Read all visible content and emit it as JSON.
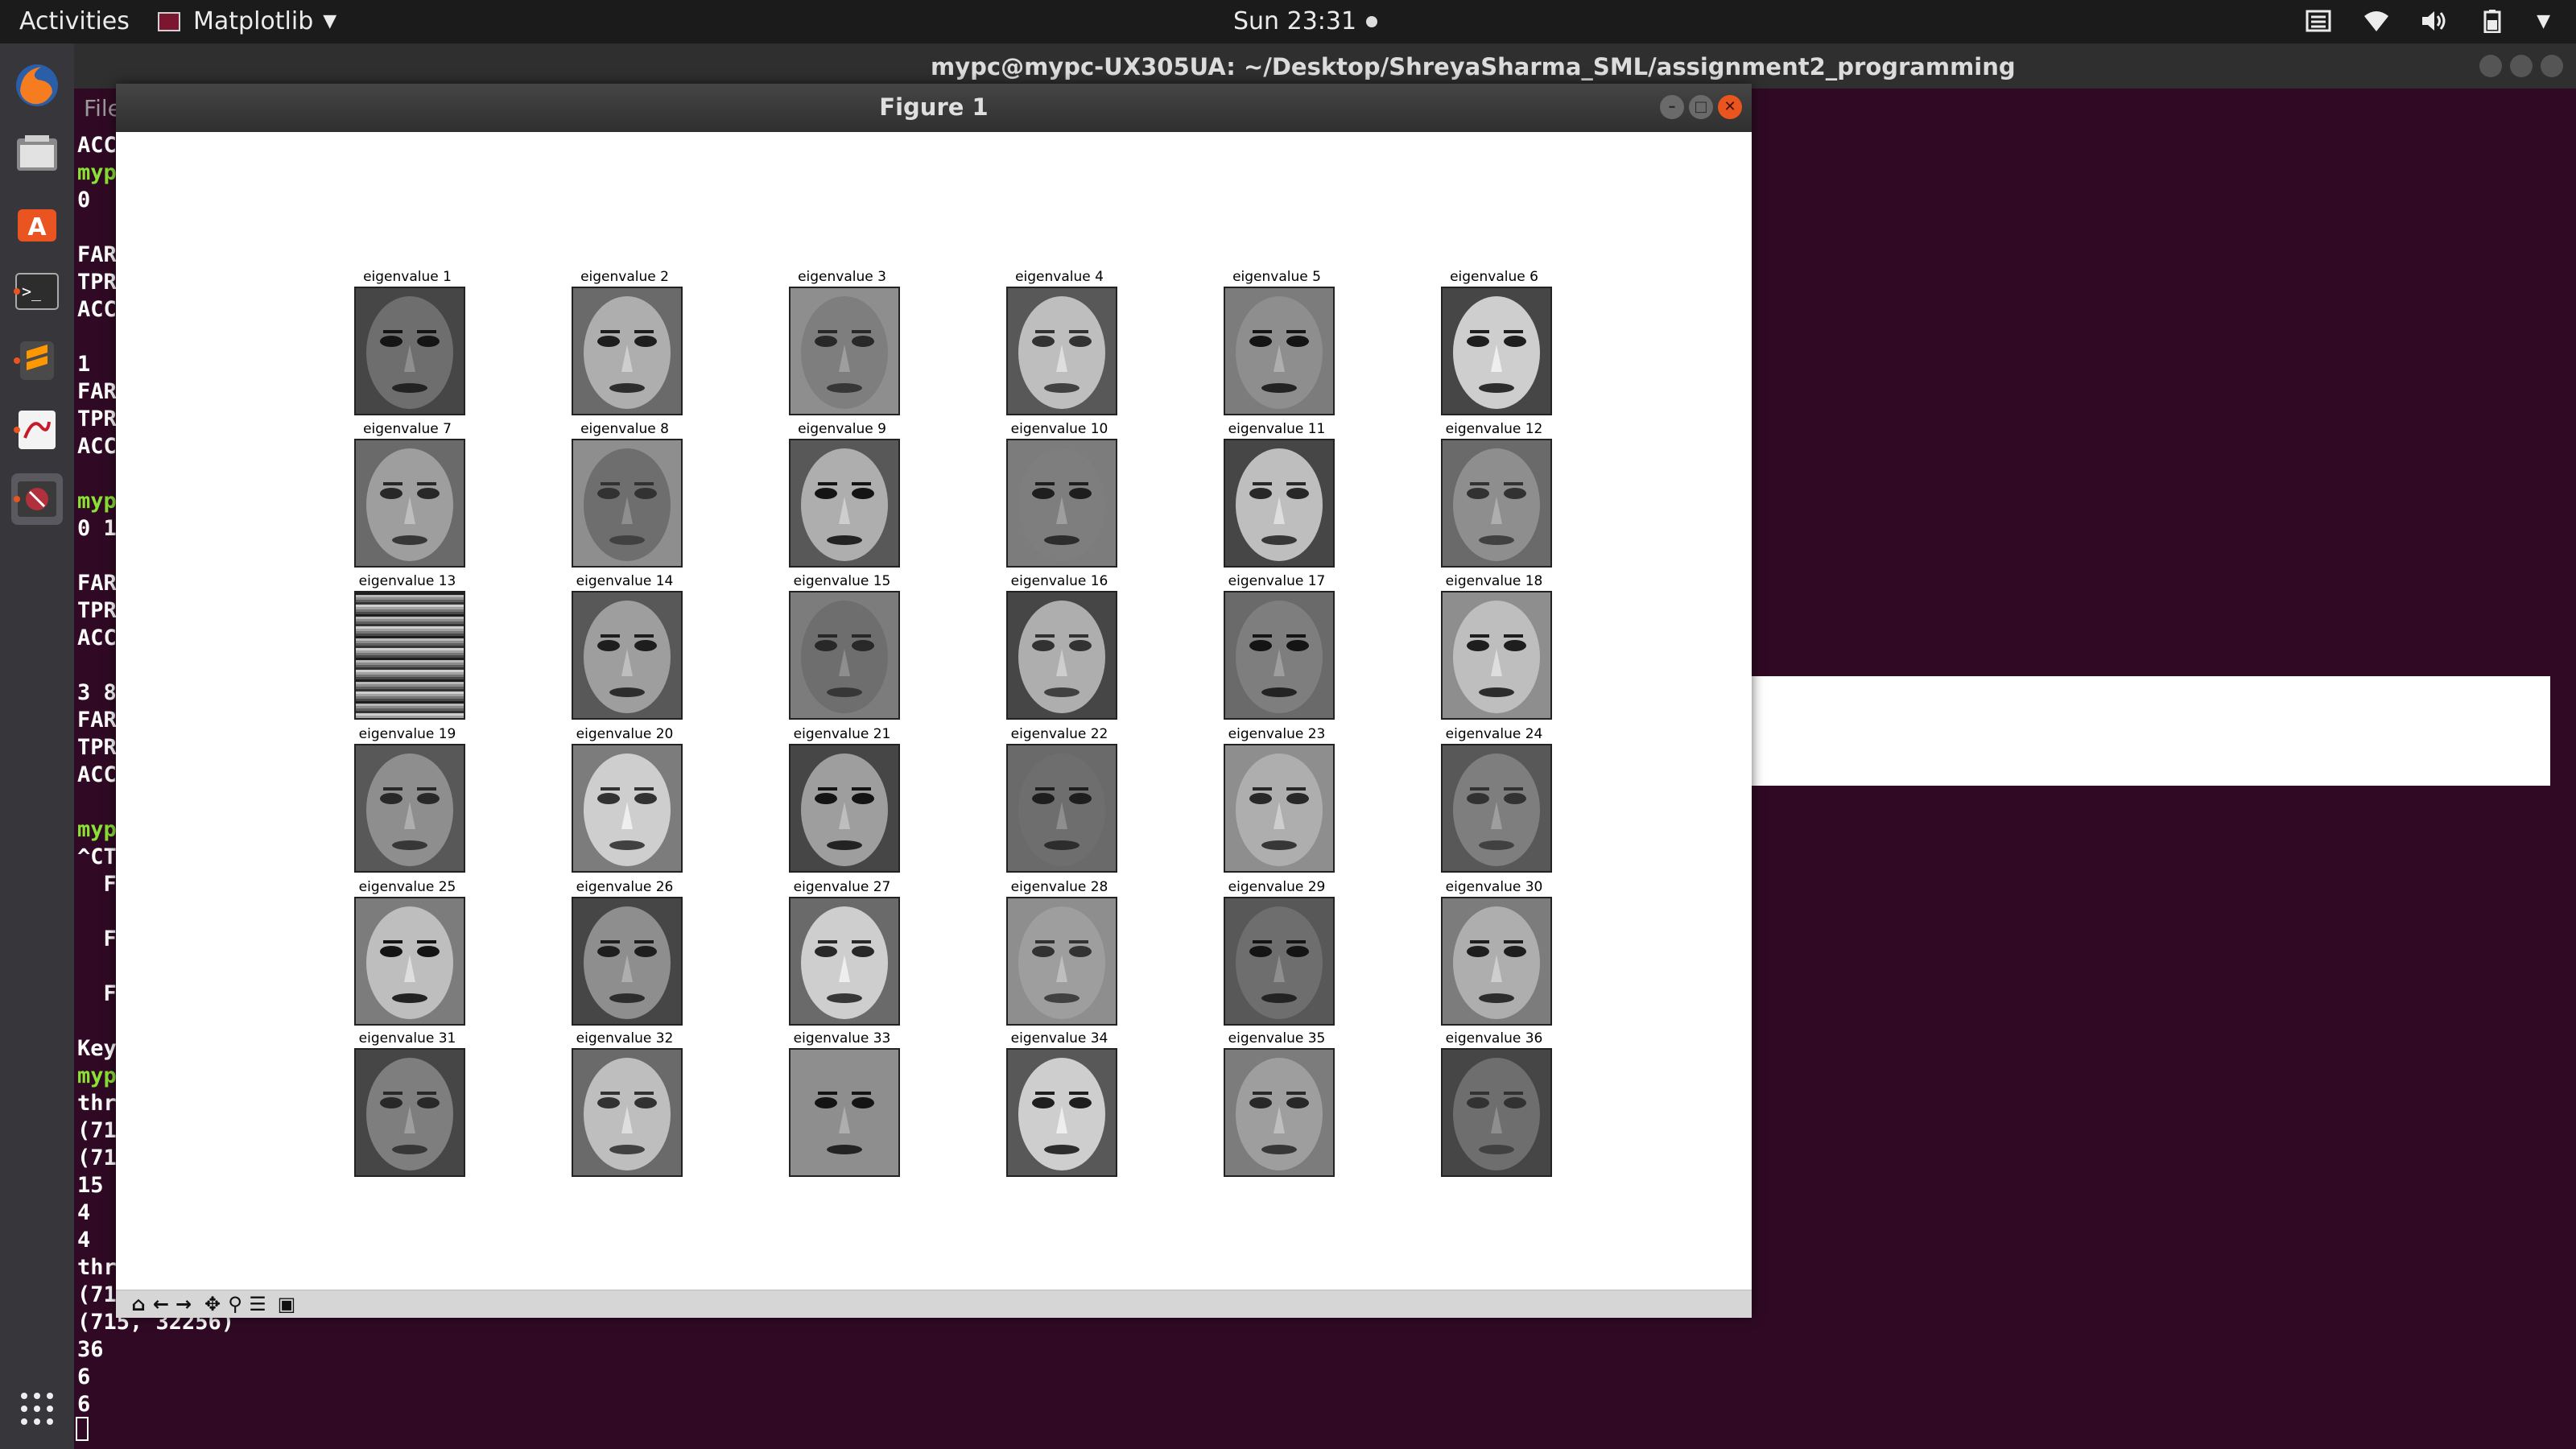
{
  "topbar": {
    "activities": "Activities",
    "app_name": "Matplotlib",
    "clock": "Sun 23:31",
    "tray_icons": [
      "input-method-icon",
      "wifi-icon",
      "volume-icon",
      "battery-icon",
      "system-menu-caret-icon"
    ]
  },
  "dock": {
    "items": [
      "firefox-icon",
      "files-icon",
      "software-center-icon",
      "terminal-icon",
      "sublime-text-icon",
      "evince-icon",
      "matplotlib-figure-icon"
    ],
    "show_apps_icon": "app-grid-icon"
  },
  "terminal": {
    "title": "mypc@mypc-UX305UA: ~/Desktop/ShreyaSharma_SML/assignment2_programming",
    "menu_fragment": "File",
    "lines": [
      {
        "text": "ACC",
        "green": false
      },
      {
        "text": "myp",
        "green": true
      },
      {
        "text": "0",
        "green": false
      },
      {
        "text": "",
        "green": false
      },
      {
        "text": "FAR",
        "green": false
      },
      {
        "text": "TPR",
        "green": false
      },
      {
        "text": "ACC",
        "green": false
      },
      {
        "text": "",
        "green": false
      },
      {
        "text": "1",
        "green": false
      },
      {
        "text": "FAR",
        "green": false
      },
      {
        "text": "TPR",
        "green": false
      },
      {
        "text": "ACC",
        "green": false
      },
      {
        "text": "",
        "green": false
      },
      {
        "text": "myp",
        "green": true
      },
      {
        "text": "0 1",
        "green": false
      },
      {
        "text": "",
        "green": false
      },
      {
        "text": "FAR",
        "green": false
      },
      {
        "text": "TPR",
        "green": false
      },
      {
        "text": "ACC",
        "green": false
      },
      {
        "text": "",
        "green": false
      },
      {
        "text": "3 8",
        "green": false
      },
      {
        "text": "FAR",
        "green": false
      },
      {
        "text": "TPR",
        "green": false
      },
      {
        "text": "ACC",
        "green": false
      },
      {
        "text": "",
        "green": false
      },
      {
        "text": "myp",
        "green": true
      },
      {
        "text": "^CT",
        "green": false
      },
      {
        "text": "  F",
        "green": false
      },
      {
        "text": "",
        "green": false
      },
      {
        "text": "  F",
        "green": false
      },
      {
        "text": "",
        "green": false
      },
      {
        "text": "  F",
        "green": false
      },
      {
        "text": "",
        "green": false
      },
      {
        "text": "Key",
        "green": false
      },
      {
        "text": "myp",
        "green": true
      },
      {
        "text": "thr",
        "green": false
      },
      {
        "text": "(71",
        "green": false
      },
      {
        "text": "(71",
        "green": false
      },
      {
        "text": "15",
        "green": false
      },
      {
        "text": "4",
        "green": false
      },
      {
        "text": "4",
        "green": false
      },
      {
        "text": "thr",
        "green": false
      },
      {
        "text": "(71",
        "green": false
      },
      {
        "text": "(715, 32256)",
        "green": false
      },
      {
        "text": "36",
        "green": false
      },
      {
        "text": "6",
        "green": false
      },
      {
        "text": "6",
        "green": false
      }
    ]
  },
  "figure": {
    "title": "Figure 1",
    "captions": [
      "eigenvalue 1",
      "eigenvalue 2",
      "eigenvalue 3",
      "eigenvalue 4",
      "eigenvalue 5",
      "eigenvalue 6",
      "eigenvalue 7",
      "eigenvalue 8",
      "eigenvalue 9",
      "eigenvalue 10",
      "eigenvalue 11",
      "eigenvalue 12",
      "eigenvalue 13",
      "eigenvalue 14",
      "eigenvalue 15",
      "eigenvalue 16",
      "eigenvalue 17",
      "eigenvalue 18",
      "eigenvalue 19",
      "eigenvalue 20",
      "eigenvalue 21",
      "eigenvalue 22",
      "eigenvalue 23",
      "eigenvalue 24",
      "eigenvalue 25",
      "eigenvalue 26",
      "eigenvalue 27",
      "eigenvalue 28",
      "eigenvalue 29",
      "eigenvalue 30",
      "eigenvalue 31",
      "eigenvalue 32",
      "eigenvalue 33",
      "eigenvalue 34",
      "eigenvalue 35",
      "eigenvalue 36"
    ],
    "grid_rows": 6,
    "grid_cols": 6,
    "toolbar_buttons": [
      {
        "name": "home-icon",
        "glyph": "⌂"
      },
      {
        "name": "back-arrow-icon",
        "glyph": "←"
      },
      {
        "name": "forward-arrow-icon",
        "glyph": "→"
      },
      {
        "name": "pan-icon",
        "glyph": "✥"
      },
      {
        "name": "zoom-icon",
        "glyph": "⚲"
      },
      {
        "name": "configure-subplots-icon",
        "glyph": "☰"
      },
      {
        "name": "save-icon",
        "glyph": "▣"
      }
    ]
  }
}
